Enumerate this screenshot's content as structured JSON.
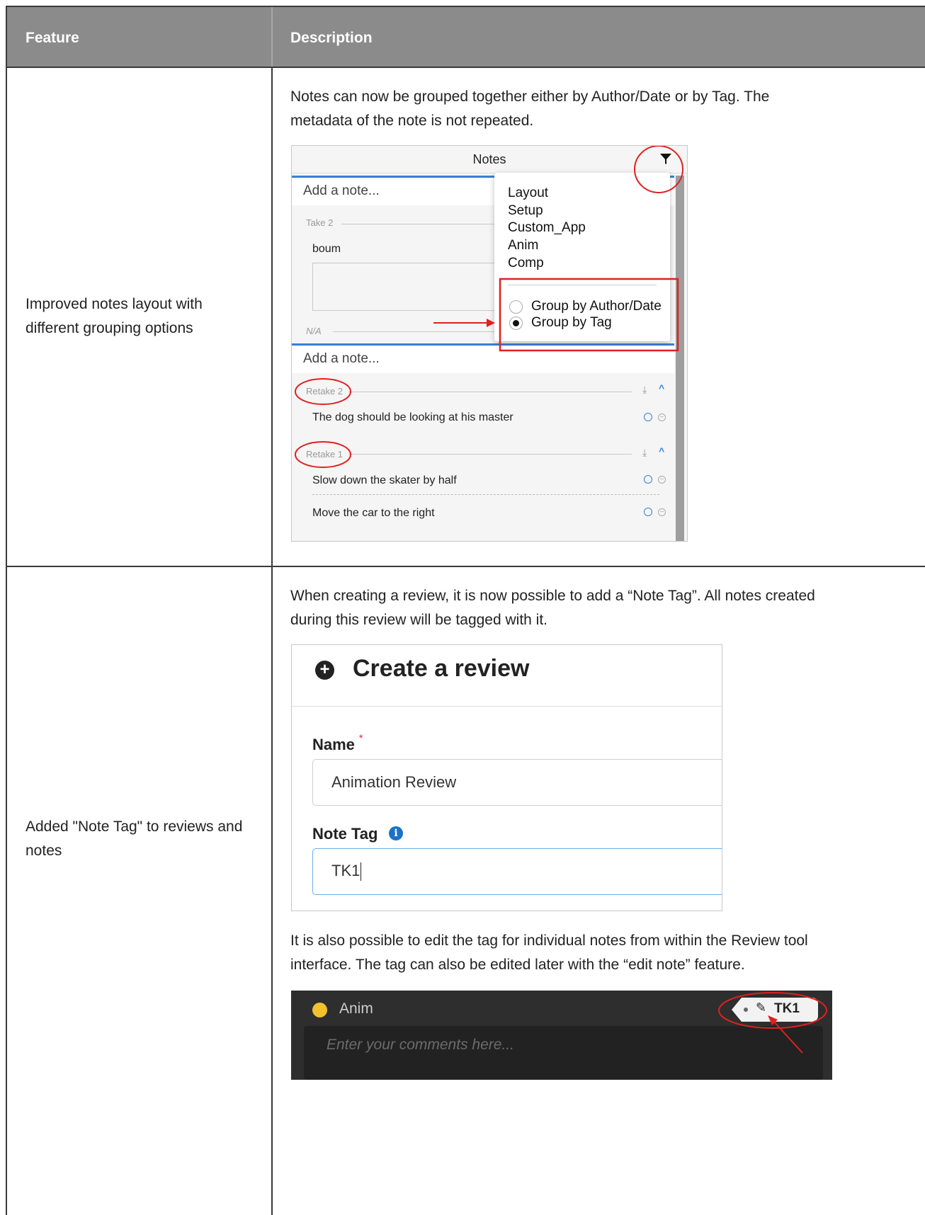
{
  "table": {
    "headers": [
      "Feature",
      "Description"
    ],
    "rows": [
      {
        "feature": "Improved notes layout with different grouping options",
        "description": "Notes can now be grouped together either by Author/Date or by Tag. The metadata of the note is not repeated."
      },
      {
        "feature": "Added \"Note Tag\" to reviews and notes",
        "description": "When creating a review, it is now possible to add a “Note Tag”. All notes created during this review will be tagged with it.",
        "description2": "It is also possible to edit the tag for individual notes from within the Review tool interface. The tag can also be edited later with the “edit note” feature."
      }
    ]
  },
  "notes_panel": {
    "title": "Notes",
    "add_placeholder": "Add a note...",
    "group_take2": "Take 2",
    "note_boum": "boum",
    "group_na": "N/A",
    "group_retake2": "Retake 2",
    "note_retake2": "The dog should be looking at his master",
    "group_retake1": "Retake 1",
    "note_retake1_a": "Slow down the skater by half",
    "note_retake1_b": "Move the car to the right",
    "menu": {
      "tags": [
        "Layout",
        "Setup",
        "Custom_App",
        "Anim",
        "Comp"
      ],
      "group_author": "Group by Author/Date",
      "group_tag": "Group by Tag",
      "selected": "Group by Tag"
    }
  },
  "review_form": {
    "title": "Create a review",
    "name_label": "Name",
    "required_mark": "*",
    "name_value": "Animation Review",
    "tag_label": "Note Tag",
    "tag_value": "TK1"
  },
  "review_tool": {
    "layer_name": "Anim",
    "comment_placeholder": "Enter your comments here...",
    "tag": "TK1"
  },
  "colors": {
    "header_bg": "#8b8b8b",
    "accent_blue": "#3b7fd4",
    "annotation_red": "#e02020",
    "layer_dot": "#f2c12e"
  }
}
